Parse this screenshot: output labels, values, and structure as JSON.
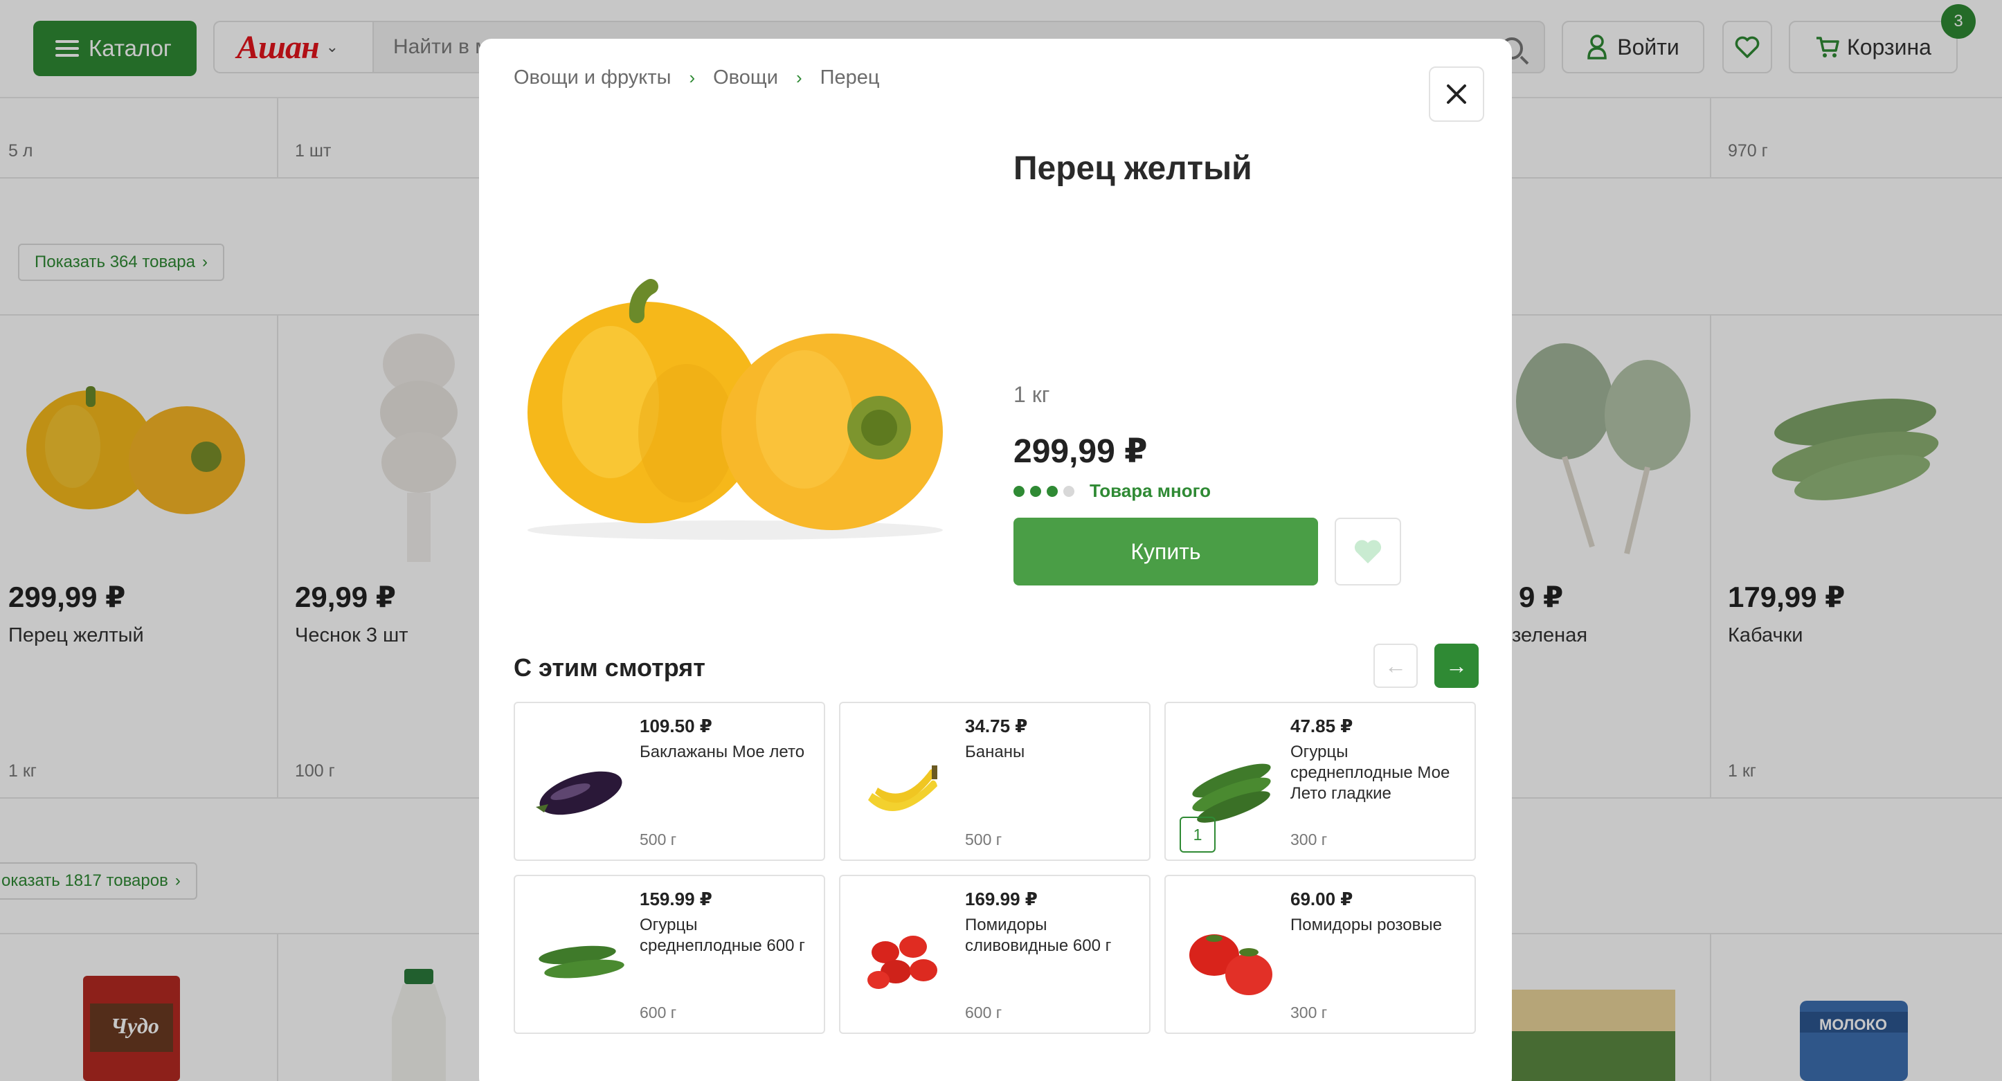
{
  "header": {
    "catalog_label": "Каталог",
    "logo_text": "Ашан",
    "search_placeholder": "Найти в м",
    "login_label": "Войти",
    "cart_label": "Корзина",
    "cart_count": "3",
    "brand_color": "#2f8a34",
    "logo_color": "#e3141c"
  },
  "background": {
    "row1_weights": [
      "5 л",
      "1 шт",
      "970 г"
    ],
    "show_more_1": "Показать 364 товара",
    "products": [
      {
        "price": "299,99 ₽",
        "name": "Перец желтый",
        "weight": "1 кг"
      },
      {
        "price": "29,99 ₽",
        "name": "Чеснок 3 шт",
        "weight": "100 г"
      },
      {
        "price": "9 ₽",
        "name": "зеленая",
        "weight": ""
      },
      {
        "price": "179,99 ₽",
        "name": "Кабачки",
        "weight": "1 кг"
      }
    ],
    "show_more_2": "оказать 1817 товаров",
    "bottom_text": [
      "Чудо",
      "МОЛОКО"
    ]
  },
  "modal": {
    "breadcrumb": [
      "Овощи и фрукты",
      "Овощи",
      "Перец"
    ],
    "title": "Перец желтый",
    "weight": "1 кг",
    "price": "299,99 ₽",
    "stock_text": "Товара много",
    "stock_level": 3,
    "stock_max": 4,
    "buy_label": "Купить",
    "related_title": "С этим смотрят",
    "related": [
      {
        "price": "109.50 ₽",
        "name": "Баклажаны Мое лето",
        "weight": "500 г",
        "icon": "eggplant-image"
      },
      {
        "price": "34.75 ₽",
        "name": "Бананы",
        "weight": "500 г",
        "icon": "banana-image"
      },
      {
        "price": "47.85 ₽",
        "name": "Огурцы среднеплодные Мое Лето гладкие",
        "weight": "300 г",
        "icon": "cucumber-image",
        "qty": "1"
      },
      {
        "price": "159.99 ₽",
        "name": "Огурцы среднеплодные 600 г",
        "weight": "600 г",
        "icon": "cucumber-image"
      },
      {
        "price": "169.99 ₽",
        "name": "Помидоры сливовидные 600 г",
        "weight": "600 г",
        "icon": "tomato-image"
      },
      {
        "price": "69.00 ₽",
        "name": "Помидоры розовые",
        "weight": "300 г",
        "icon": "tomato-image"
      }
    ]
  }
}
